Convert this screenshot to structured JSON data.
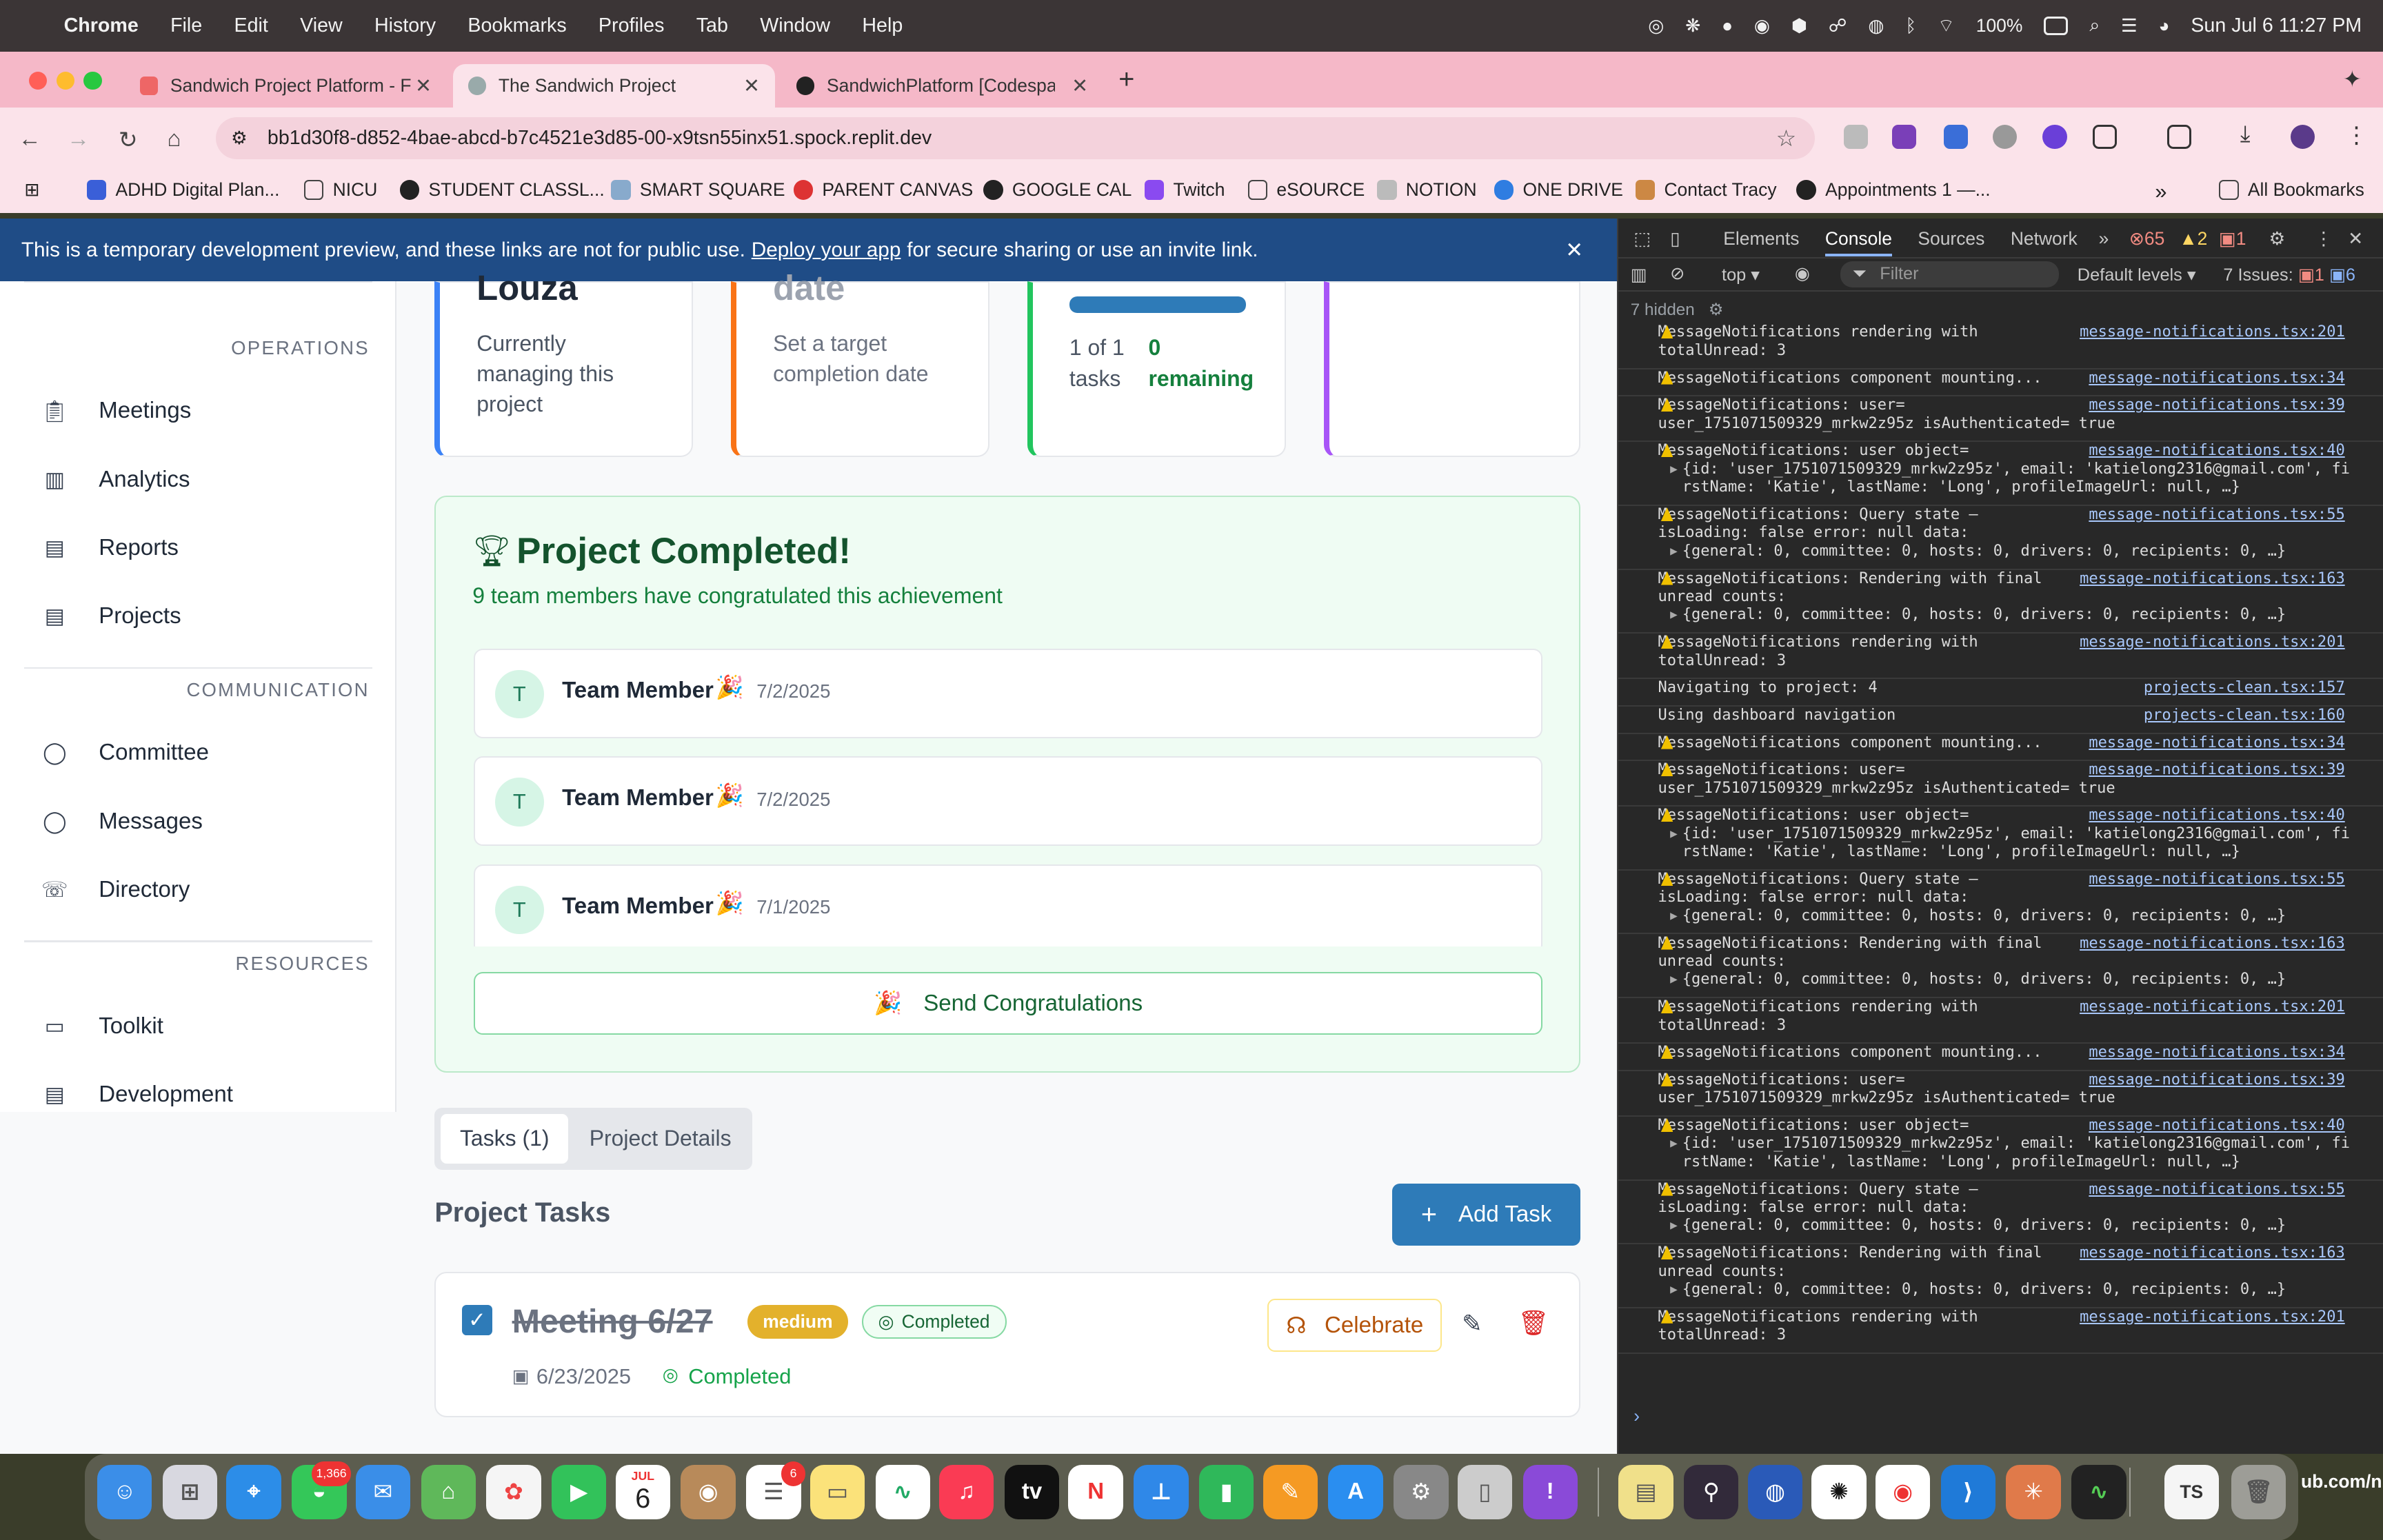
{
  "menubar": {
    "app": "Chrome",
    "items": [
      "File",
      "Edit",
      "View",
      "History",
      "Bookmarks",
      "Profiles",
      "Tab",
      "Window",
      "Help"
    ],
    "battery": "100%",
    "datetime": "Sun Jul 6  11:27 PM"
  },
  "tabs": [
    {
      "title": "Sandwich Project Platform - F"
    },
    {
      "title": "The Sandwich Project"
    },
    {
      "title": "SandwichPlatform [Codespac"
    }
  ],
  "address": {
    "url": "bb1d30f8-d852-4bae-abcd-b7c4521e3d85-00-x9tsn55inx51.spock.replit.dev"
  },
  "bookmarks": [
    "ADHD Digital Plan...",
    "NICU",
    "STUDENT CLASSL...",
    "SMART SQUARE",
    "PARENT CANVAS",
    "GOOGLE CAL",
    "Twitch",
    "eSOURCE",
    "NOTION",
    "ONE DRIVE",
    "Contact Tracy",
    "Appointments 1 —..."
  ],
  "all_bookmarks": "All Bookmarks",
  "banner": {
    "text_before": "This is a temporary development preview, and these links are not for public use.",
    "link": "Deploy your app",
    "text_after": "for secure sharing or use an invite link."
  },
  "sidebar": {
    "sections": [
      {
        "title": "OPERATIONS",
        "items": [
          "Meetings",
          "Analytics",
          "Reports",
          "Projects"
        ]
      },
      {
        "title": "COMMUNICATION",
        "items": [
          "Committee",
          "Messages",
          "Directory"
        ]
      },
      {
        "title": "RESOURCES",
        "items": [
          "Toolkit",
          "Development"
        ]
      }
    ]
  },
  "cards": {
    "owner_name": "Louza",
    "owner_desc": "Currently managing this project",
    "date_title": "date",
    "date_desc": "Set a target completion date",
    "progress_tasks": "1 of 1 tasks",
    "progress_remaining": "0 remaining",
    "progress_value": 1.0
  },
  "completed": {
    "title": "Project Completed!",
    "subtitle": "9 team members have congratulated this achievement",
    "members": [
      {
        "initial": "T",
        "name": "Team Member",
        "date": "7/2/2025"
      },
      {
        "initial": "T",
        "name": "Team Member",
        "date": "7/2/2025"
      },
      {
        "initial": "T",
        "name": "Team Member",
        "date": "7/1/2025"
      }
    ],
    "send_button": "Send Congratulations"
  },
  "content_tabs": {
    "tasks": "Tasks (1)",
    "details": "Project Details"
  },
  "tasks_section": {
    "title": "Project Tasks",
    "add_button": "Add Task"
  },
  "task": {
    "name": "Meeting 6/27",
    "priority": "medium",
    "status_badge": "Completed",
    "date": "6/23/2025",
    "status": "Completed",
    "celebrate": "Celebrate"
  },
  "devtools": {
    "tabs": [
      "Elements",
      "Console",
      "Sources",
      "Network"
    ],
    "errors": "65",
    "warnings": "2",
    "issues_badge": "1",
    "context": "top",
    "filter_placeholder": "Filter",
    "levels": "Default levels",
    "issues": "7 Issues:",
    "issues_err": "1",
    "issues_info": "6",
    "hidden": "7 hidden"
  },
  "console": [
    {
      "warn": true,
      "lines": [
        "MessageNotifications rendering with",
        "totalUnread: 3"
      ],
      "src": "message-notifications.tsx:201"
    },
    {
      "warn": true,
      "lines": [
        "MessageNotifications component mounting..."
      ],
      "src": "message-notifications.tsx:34"
    },
    {
      "warn": true,
      "lines": [
        "MessageNotifications: user=",
        "user_1751071509329_mrkw2z95z isAuthenticated= true"
      ],
      "src": "message-notifications.tsx:39"
    },
    {
      "warn": true,
      "lines": [
        "MessageNotifications: user object=",
        "{id: 'user_1751071509329_mrkw2z95z', email: 'katielong2316@gmail.com', fi",
        "rstName: 'Katie', lastName: 'Long', profileImageUrl: null, …}"
      ],
      "src": "message-notifications.tsx:40"
    },
    {
      "warn": true,
      "lines": [
        "MessageNotifications: Query state –",
        "isLoading: false error: null data:",
        "{general: 0, committee: 0, hosts: 0, drivers: 0, recipients: 0, …}"
      ],
      "src": "message-notifications.tsx:55"
    },
    {
      "warn": true,
      "lines": [
        "MessageNotifications: Rendering with final",
        "unread counts:",
        "{general: 0, committee: 0, hosts: 0, drivers: 0, recipients: 0, …}"
      ],
      "src": "message-notifications.tsx:163"
    },
    {
      "warn": true,
      "lines": [
        "MessageNotifications rendering with",
        "totalUnread: 3"
      ],
      "src": "message-notifications.tsx:201"
    },
    {
      "warn": false,
      "lines": [
        "Navigating to project: 4"
      ],
      "src": "projects-clean.tsx:157"
    },
    {
      "warn": false,
      "lines": [
        "Using dashboard navigation"
      ],
      "src": "projects-clean.tsx:160"
    },
    {
      "warn": true,
      "lines": [
        "MessageNotifications component mounting..."
      ],
      "src": "message-notifications.tsx:34"
    },
    {
      "warn": true,
      "lines": [
        "MessageNotifications: user=",
        "user_1751071509329_mrkw2z95z isAuthenticated= true"
      ],
      "src": "message-notifications.tsx:39"
    },
    {
      "warn": true,
      "lines": [
        "MessageNotifications: user object=",
        "{id: 'user_1751071509329_mrkw2z95z', email: 'katielong2316@gmail.com', fi",
        "rstName: 'Katie', lastName: 'Long', profileImageUrl: null, …}"
      ],
      "src": "message-notifications.tsx:40"
    },
    {
      "warn": true,
      "lines": [
        "MessageNotifications: Query state –",
        "isLoading: false error: null data:",
        "{general: 0, committee: 0, hosts: 0, drivers: 0, recipients: 0, …}"
      ],
      "src": "message-notifications.tsx:55"
    },
    {
      "warn": true,
      "lines": [
        "MessageNotifications: Rendering with final",
        "unread counts:",
        "{general: 0, committee: 0, hosts: 0, drivers: 0, recipients: 0, …}"
      ],
      "src": "message-notifications.tsx:163"
    },
    {
      "warn": true,
      "lines": [
        "MessageNotifications rendering with",
        "totalUnread: 3"
      ],
      "src": "message-notifications.tsx:201"
    },
    {
      "warn": true,
      "lines": [
        "MessageNotifications component mounting..."
      ],
      "src": "message-notifications.tsx:34"
    },
    {
      "warn": true,
      "lines": [
        "MessageNotifications: user=",
        "user_1751071509329_mrkw2z95z isAuthenticated= true"
      ],
      "src": "message-notifications.tsx:39"
    },
    {
      "warn": true,
      "lines": [
        "MessageNotifications: user object=",
        "{id: 'user_1751071509329_mrkw2z95z', email: 'katielong2316@gmail.com', fi",
        "rstName: 'Katie', lastName: 'Long', profileImageUrl: null, …}"
      ],
      "src": "message-notifications.tsx:40"
    },
    {
      "warn": true,
      "lines": [
        "MessageNotifications: Query state –",
        "isLoading: false error: null data:",
        "{general: 0, committee: 0, hosts: 0, drivers: 0, recipients: 0, …}"
      ],
      "src": "message-notifications.tsx:55"
    },
    {
      "warn": true,
      "lines": [
        "MessageNotifications: Rendering with final",
        "unread counts:",
        "{general: 0, committee: 0, hosts: 0, drivers: 0, recipients: 0, …}"
      ],
      "src": "message-notifications.tsx:163"
    },
    {
      "warn": true,
      "lines": [
        "MessageNotifications rendering with",
        "totalUnread: 3"
      ],
      "src": "message-notifications.tsx:201"
    }
  ],
  "dock": {
    "messages_badge": "1,366",
    "calendar_month": "JUL",
    "calendar_day": "6",
    "reminders_badge": "6",
    "ts_label": "TS",
    "wallpaper_text": "ub.com/nic"
  },
  "colors": {
    "accent_blue": "#2e7bb8",
    "success_green": "#16a34a",
    "priority_yellow": "#e3b12c",
    "banner_blue": "#1f4c86"
  }
}
